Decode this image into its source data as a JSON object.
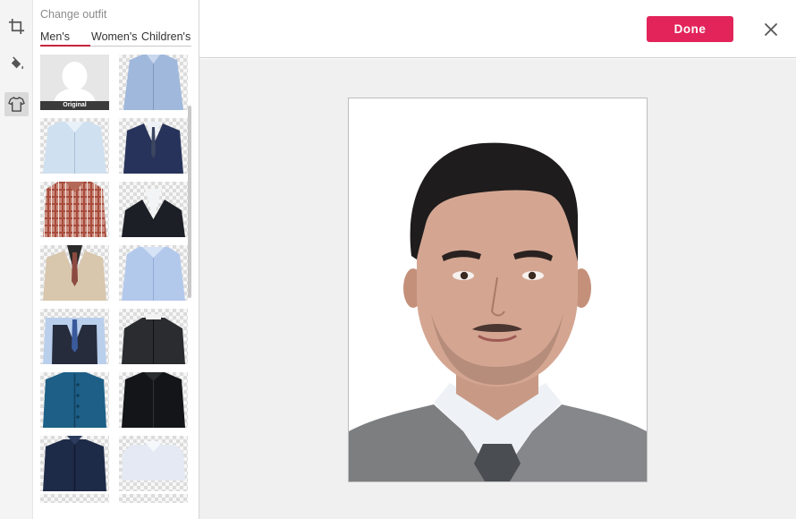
{
  "panel": {
    "title": "Change outfit",
    "tabs": [
      {
        "label": "Men's",
        "active": true
      },
      {
        "label": "Women's",
        "active": false
      },
      {
        "label": "Children's",
        "active": false
      }
    ]
  },
  "tools": [
    {
      "icon": "crop-icon"
    },
    {
      "icon": "paint-bucket-icon"
    },
    {
      "icon": "shirt-icon",
      "active": true
    }
  ],
  "outfits": [
    {
      "name": "Original",
      "label": "Original"
    },
    {
      "name": "light-blue-shirt"
    },
    {
      "name": "white-blue-shirt"
    },
    {
      "name": "navy-suit-tie"
    },
    {
      "name": "plaid-shirt"
    },
    {
      "name": "black-suit-white-shirt"
    },
    {
      "name": "beige-suit-tie"
    },
    {
      "name": "light-blue-collar-shirt"
    },
    {
      "name": "navy-vest-tie"
    },
    {
      "name": "black-mandarin-jacket"
    },
    {
      "name": "teal-mandarin-jacket"
    },
    {
      "name": "black-shirt"
    },
    {
      "name": "navy-jacket"
    },
    {
      "name": "white-shirt"
    }
  ],
  "header": {
    "done_label": "Done",
    "close_icon": "close-icon"
  },
  "colors": {
    "accent": "#e2245a",
    "tab_underline": "#c8243f"
  }
}
